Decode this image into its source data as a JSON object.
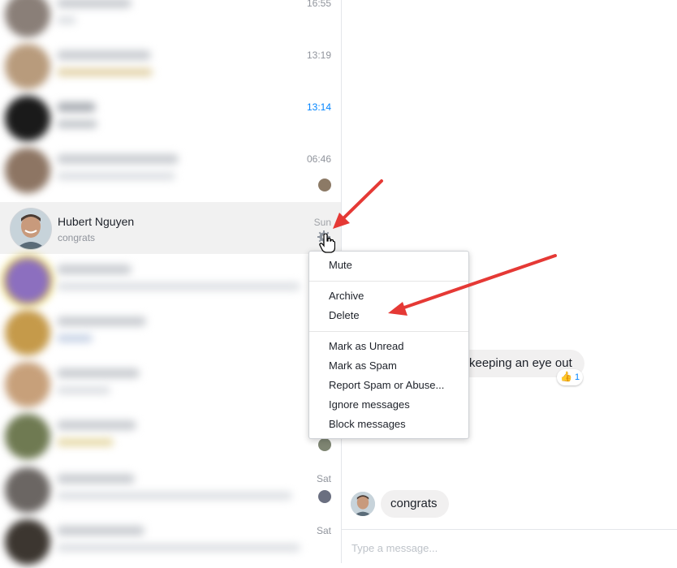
{
  "conversations_top": [
    {
      "time": "16:55",
      "unread": false
    },
    {
      "time": "13:19",
      "unread": false
    },
    {
      "time": "13:14",
      "unread": true
    },
    {
      "time": "06:46",
      "unread": false
    }
  ],
  "selected_conversation": {
    "name": "Hubert Nguyen",
    "snippet": "congrats",
    "time": "Sun"
  },
  "conversations_bottom": [
    {
      "time": ""
    },
    {
      "time": ""
    },
    {
      "time": ""
    },
    {
      "time": ""
    },
    {
      "time": "Sat"
    },
    {
      "time": "Sat"
    }
  ],
  "context_menu": {
    "mute": "Mute",
    "archive": "Archive",
    "delete": "Delete",
    "mark_unread": "Mark as Unread",
    "mark_spam": "Mark as Spam",
    "report": "Report Spam or Abuse...",
    "ignore": "Ignore messages",
    "block": "Block messages"
  },
  "chat": {
    "partial_message": "keeping an eye out",
    "reaction_emoji": "👍",
    "reaction_count": "1",
    "last_message": "congrats"
  },
  "composer": {
    "placeholder": "Type a message..."
  },
  "colors": {
    "accent": "#0084ff",
    "arrow": "#e53935",
    "selected_row": "#f1f1f1"
  }
}
